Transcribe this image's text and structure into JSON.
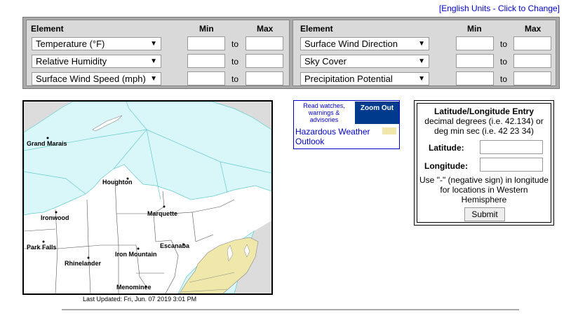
{
  "header": {
    "units_link": "[English Units - Click to Change]"
  },
  "filters": {
    "element_header": "Element",
    "min_header": "Min",
    "max_header": "Max",
    "to_label": "to",
    "left": [
      {
        "label": "Temperature (°F)",
        "min": "",
        "max": ""
      },
      {
        "label": "Relative Humidity",
        "min": "",
        "max": ""
      },
      {
        "label": "Surface Wind Speed (mph)",
        "min": "",
        "max": ""
      }
    ],
    "right": [
      {
        "label": "Surface Wind Direction",
        "min": "",
        "max": ""
      },
      {
        "label": "Sky Cover",
        "min": "",
        "max": ""
      },
      {
        "label": "Precipitation Potential",
        "min": "",
        "max": ""
      }
    ],
    "dropdown_icon": "triangle-down"
  },
  "map": {
    "cities": [
      "Grand Marais",
      "Houghton",
      "Ironwood",
      "Marquette",
      "Park Falls",
      "Rhinelander",
      "Iron Mountain",
      "Escanaba",
      "Menominee"
    ],
    "last_updated": "Last Updated: Fri, Jun. 07 2019 3:01 PM",
    "colors": {
      "marine": "#d9f6f9",
      "hazard": "#efe8aa",
      "land": "#ffffff",
      "unmapped": "#dcdcdc"
    }
  },
  "legend": {
    "watch_link": "Read watches, warnings & advisories",
    "zoom_out": "Zoom Out",
    "hazard_outlook": "Hazardous Weather Outlook",
    "hazard_color": "#efe8aa"
  },
  "latlon": {
    "title": "Latitude/Longitude Entry",
    "desc": "decimal degrees (i.e. 42.134) or deg min sec (i.e. 42 23 34)",
    "lat_label": "Latitude:",
    "lat_value": "",
    "lon_label": "Longitude:",
    "lon_value": "",
    "note": "Use \"-\" (negative sign) in longitude for locations in Western Hemisphere",
    "submit": "Submit"
  }
}
